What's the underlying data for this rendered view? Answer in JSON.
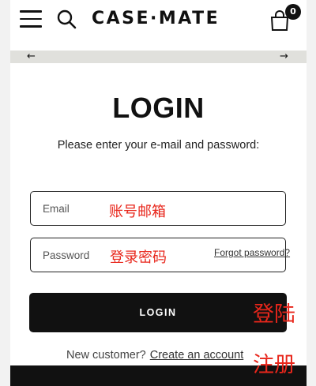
{
  "header": {
    "logo_text": "CASE·MATE",
    "cart_count": "0",
    "icons": [
      "menu-icon",
      "search-icon",
      "cart-icon"
    ]
  },
  "announcement": {
    "prev_arrow": "←",
    "next_arrow": "→"
  },
  "login": {
    "title": "LOGIN",
    "subtitle": "Please enter your e-mail and password:",
    "email_placeholder": "Email",
    "email_value": "",
    "password_placeholder": "Password",
    "password_value": "",
    "forgot_label": "Forgot password?",
    "button_label": "LOGIN",
    "new_customer_text": "New customer?",
    "create_account_label": "Create an account"
  },
  "annotations": {
    "email_note": "账号邮箱",
    "password_note": "登录密码",
    "login_note": "登陆",
    "register_note": "注册"
  },
  "colors": {
    "page_bg": "#ffffff",
    "side_bg": "#f2f2f2",
    "announce_bg": "#e0e0dc",
    "button_bg": "#111111",
    "annotation": "#e8261b"
  }
}
